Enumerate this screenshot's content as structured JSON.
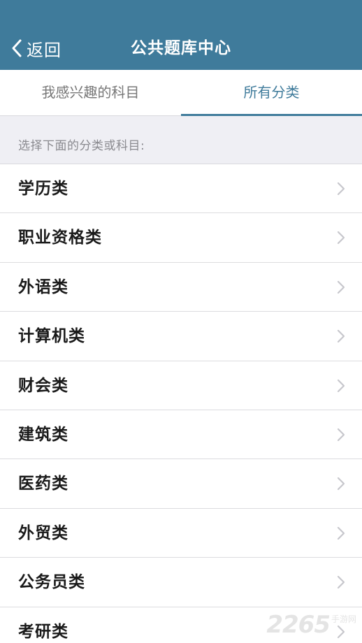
{
  "header": {
    "back_label": "返回",
    "title": "公共题库中心"
  },
  "tabs": [
    {
      "label": "我感兴趣的科目",
      "active": false
    },
    {
      "label": "所有分类",
      "active": true
    }
  ],
  "hint": "选择下面的分类或科目:",
  "categories": [
    {
      "label": "学历类"
    },
    {
      "label": "职业资格类"
    },
    {
      "label": "外语类"
    },
    {
      "label": "计算机类"
    },
    {
      "label": "财会类"
    },
    {
      "label": "建筑类"
    },
    {
      "label": "医药类"
    },
    {
      "label": "外贸类"
    },
    {
      "label": "公务员类"
    },
    {
      "label": "考研类"
    }
  ],
  "watermark": {
    "number": "2265",
    "text": "手游网"
  },
  "colors": {
    "header_bg": "#3f7b9b",
    "accent": "#3f7b9b",
    "page_bg": "#efeff4"
  }
}
